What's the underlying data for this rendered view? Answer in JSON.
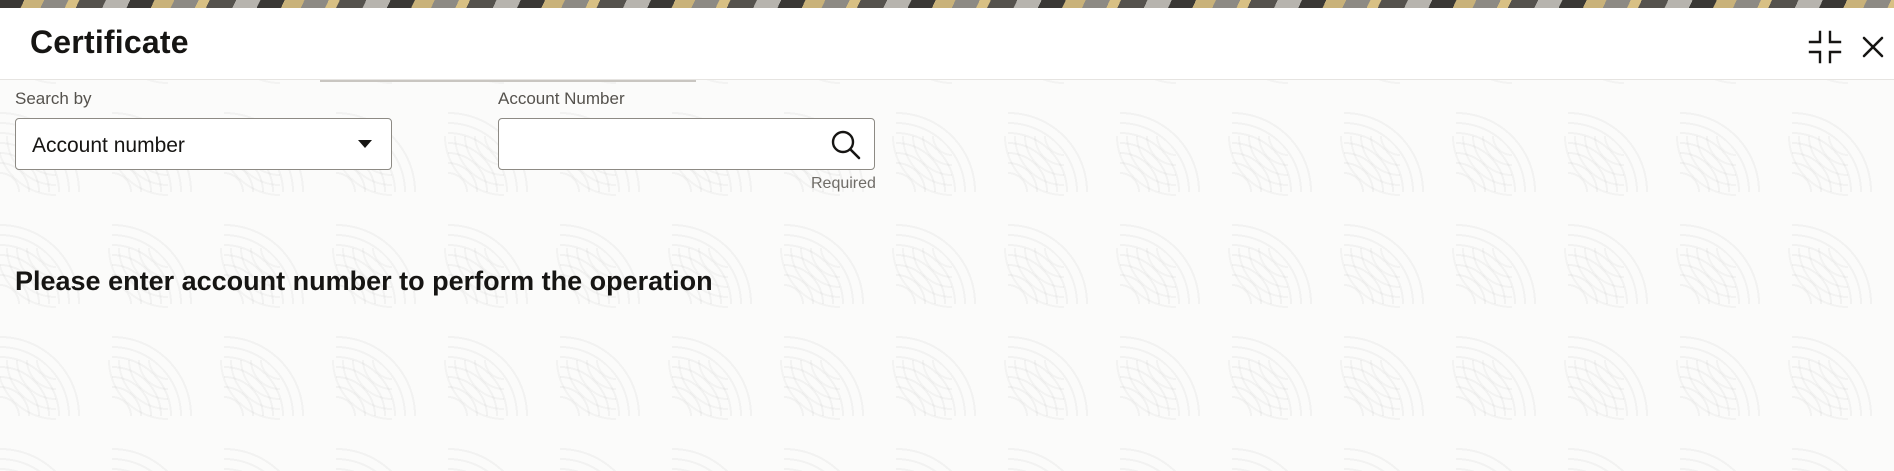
{
  "dialog": {
    "title": "Certificate",
    "minimize_icon": "minimize-icon",
    "close_icon": "close-icon"
  },
  "search": {
    "search_by_label": "Search by",
    "search_by_value": "Account number",
    "account_number_label": "Account Number",
    "account_number_value": "",
    "account_number_placeholder": "",
    "required_text": "Required",
    "search_icon": "search-icon"
  },
  "message": "Please enter account number to perform the operation",
  "colors": {
    "text": "#161513",
    "border": "#8d8a84",
    "muted": "#55524d"
  }
}
